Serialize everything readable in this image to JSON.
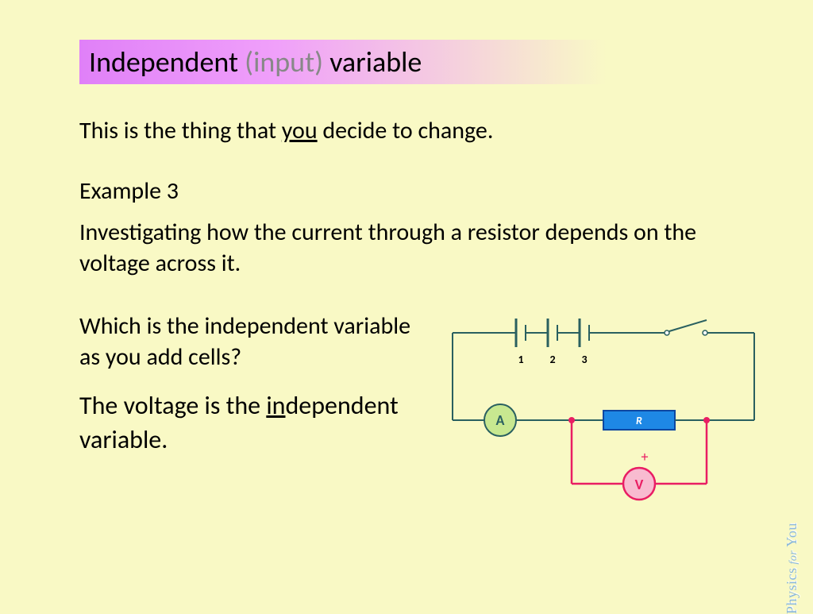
{
  "title": {
    "part1": "Independent ",
    "part2": "(input)",
    "part3": " variable"
  },
  "intro": {
    "pre": "This is the thing that ",
    "underlined": "you",
    "post": " decide to change."
  },
  "example_label": "Example 3",
  "example_text": "Investigating how the current through a resistor depends on the voltage across it.",
  "question": "Which is the independent variable as you add cells?",
  "answer": {
    "pre": "The voltage is the ",
    "underlined": "in",
    "post": "dependent variable."
  },
  "circuit": {
    "cell_labels": [
      "1",
      "2",
      "3"
    ],
    "ammeter_label": "A",
    "resistor_label": "R",
    "voltmeter_label": "V",
    "voltmeter_plus": "+"
  },
  "watermark": {
    "brand": "Physics",
    "mid": " for ",
    "suffix": "You"
  }
}
